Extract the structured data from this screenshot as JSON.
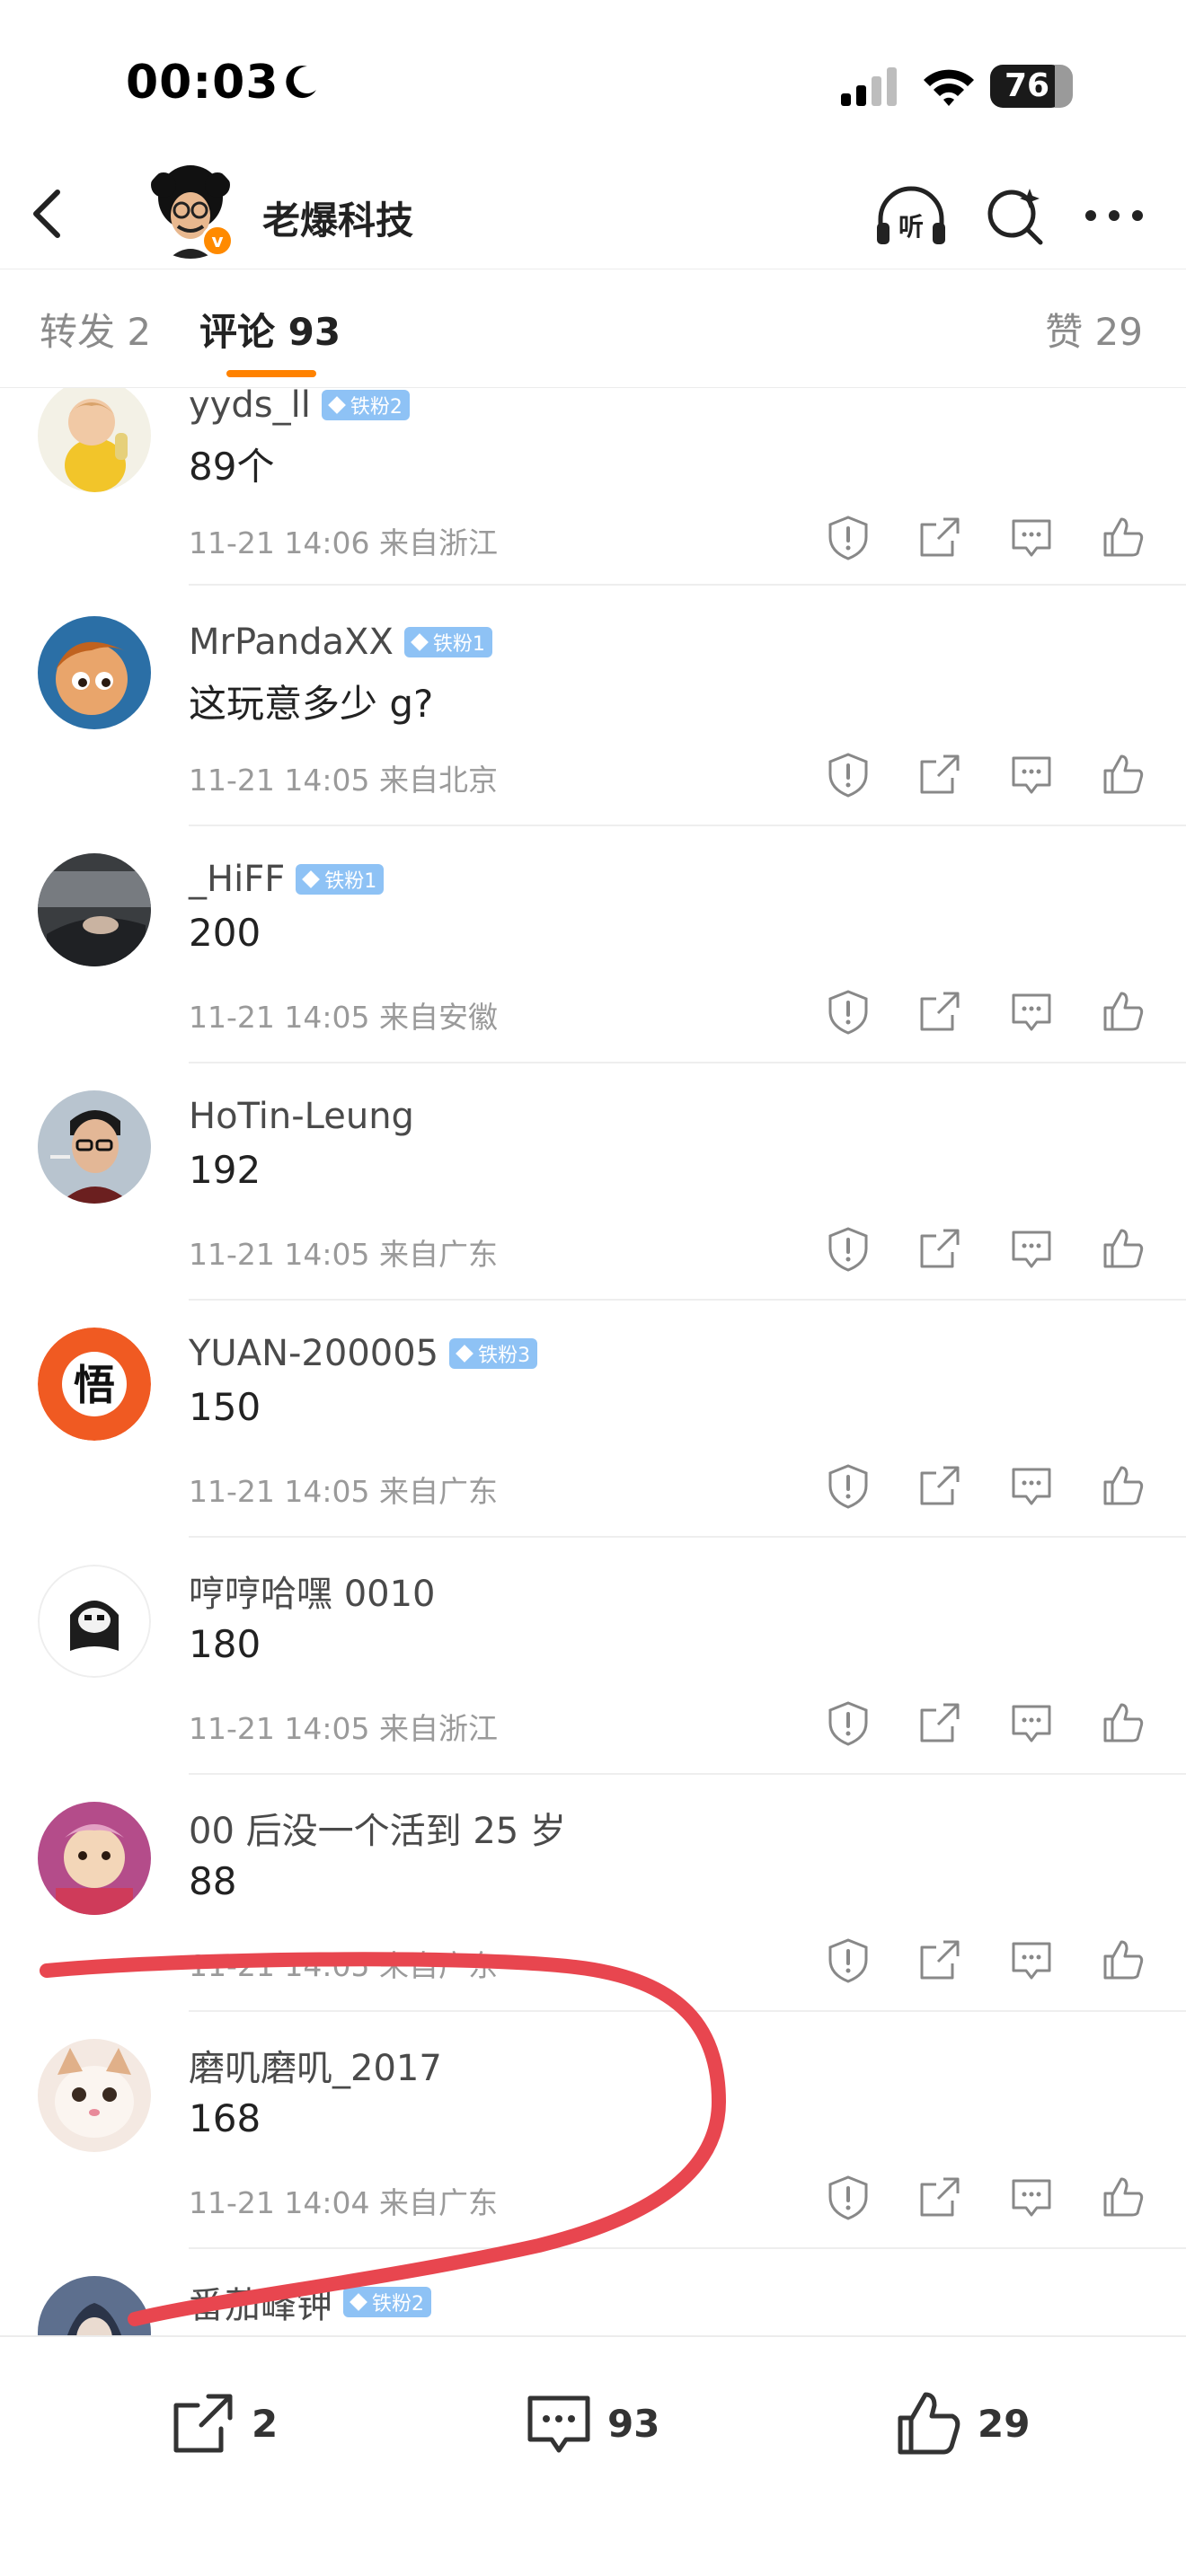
{
  "status_bar": {
    "time": "00:03",
    "battery": "76"
  },
  "header": {
    "title": "老爆科技",
    "verified_badge": "v"
  },
  "tabs": {
    "repost": "转发 2",
    "comment": "评论 93",
    "like": "赞 29"
  },
  "comments": [
    {
      "username": "yyds_ll",
      "badge": "铁粉2",
      "content": "89个",
      "meta": "11-21 14:06  来自浙江"
    },
    {
      "username": "MrPandaXX",
      "badge": "铁粉1",
      "content": "这玩意多少 g?",
      "meta": "11-21 14:05  来自北京"
    },
    {
      "username": "_HiFF",
      "badge": "铁粉1",
      "content": "200",
      "meta": "11-21 14:05  来自安徽"
    },
    {
      "username": "HoTin-Leung",
      "badge": "",
      "content": "192",
      "meta": "11-21 14:05  来自广东"
    },
    {
      "username": "YUAN-200005",
      "badge": "铁粉3",
      "content": "150",
      "meta": "11-21 14:05  来自广东"
    },
    {
      "username": "哼哼哈嘿 0010",
      "badge": "",
      "content": "180",
      "meta": "11-21 14:05  来自浙江"
    },
    {
      "username": "00 后没一个活到 25 岁",
      "badge": "",
      "content": "88",
      "meta": "11-21 14:05  来自广东"
    },
    {
      "username": "磨叽磨叽_2017",
      "badge": "",
      "content": "168",
      "meta": "11-21 14:04  来自广东"
    },
    {
      "username": "番茄峰钾",
      "badge": "铁粉2",
      "content": "",
      "meta": ""
    }
  ],
  "bottom_bar": {
    "repost_count": "2",
    "comment_count": "93",
    "like_count": "29"
  },
  "icons": {
    "report": "report-icon",
    "share": "share-icon",
    "reply": "comment-icon",
    "like": "thumbs-up-icon"
  },
  "colors": {
    "accent": "#ff8200",
    "fan_badge": "#8ec2f5",
    "annotation": "#e8464f"
  }
}
